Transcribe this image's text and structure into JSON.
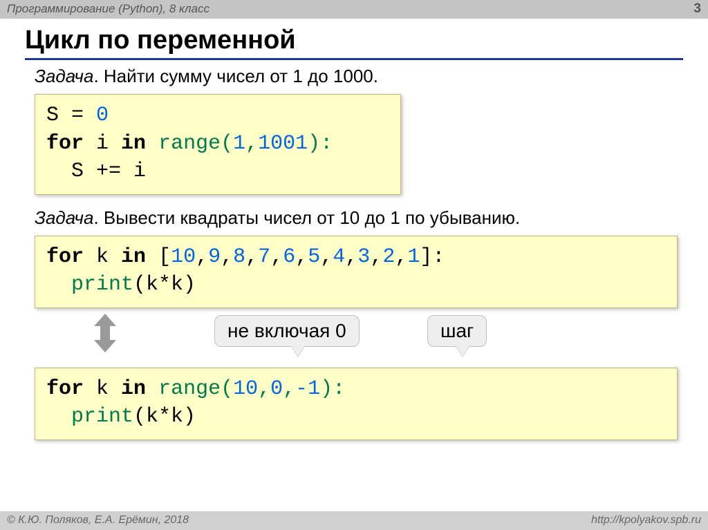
{
  "header": {
    "course": "Программирование (Python), 8 класс",
    "page": "3"
  },
  "title": "Цикл по переменной",
  "task1": {
    "label": "Задача",
    "text": ". Найти сумму чисел от 1 до 1000."
  },
  "code1": {
    "l1a": "S = ",
    "l1n": "0",
    "l2kw": "for",
    "l2mid": " i ",
    "l2in": "in",
    "l2sp": " ",
    "l2range": "range(",
    "l2n1": "1",
    "l2c": ",",
    "l2n2": "1001",
    "l2end": "):",
    "l3": "  S += i"
  },
  "task2": {
    "label": "Задача",
    "text": ". Вывести квадраты чисел от 10 до 1 по убыванию."
  },
  "code2": {
    "kw_for": "for",
    "sp1": " k ",
    "kw_in": "in",
    "sp2": " ",
    "lb": "[",
    "n10": "10",
    "c1": ",",
    "n9": "9",
    "c2": ",",
    "n8": "8",
    "c3": ",",
    "n7": "7",
    "c4": ",",
    "n6": "6",
    "c5": ",",
    "n5": "5",
    "c6": ",",
    "n4": "4",
    "c7": ",",
    "n3": "3",
    "c8": ",",
    "n2": "2",
    "c9": ",",
    "n1": "1",
    "rb": "]:",
    "l2a": "  ",
    "l2p": "print",
    "l2b": "(k*k)"
  },
  "callouts": {
    "not_including": "не включая 0",
    "step": "шаг"
  },
  "code3": {
    "kw_for": "for",
    "sp1": " k ",
    "kw_in": "in",
    "sp2": " ",
    "range": "range(",
    "n10": "10",
    "c1": ",",
    "n0": "0",
    "c2": ",",
    "nm1": "-1",
    "end": "):",
    "l2a": "  ",
    "l2p": "print",
    "l2b": "(k*k)"
  },
  "footer": {
    "copyright": "© К.Ю. Поляков, Е.А. Ерёмин, 2018",
    "url": "http://kpolyakov.spb.ru"
  }
}
